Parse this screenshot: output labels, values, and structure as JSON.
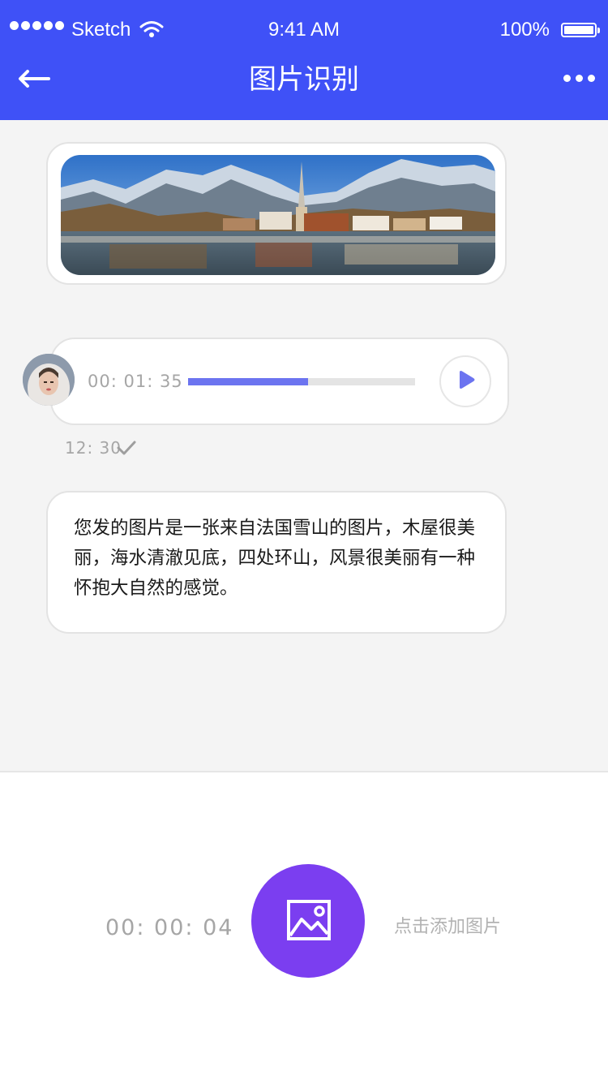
{
  "status_bar": {
    "carrier": "Sketch",
    "time": "9:41 AM",
    "battery": "100%"
  },
  "nav": {
    "title": "图片识别",
    "back_icon": "arrow-left-icon",
    "more_icon": "more-dots-icon"
  },
  "chat": {
    "image_message": {
      "alt": "lake-mountain-village-photo"
    },
    "voice_message": {
      "duration": "00: 01: 35",
      "progress": 0.53,
      "timestamp": "12: 30"
    },
    "reply_text": "您发的图片是一张来自法国雪山的图片，木屋很美丽，海水清澈见底，四处环山，风景很美丽有一种怀抱大自然的感觉。"
  },
  "bottom_panel": {
    "record_time": "00: 00: 04",
    "add_image_hint": "点击添加图片",
    "button_icon": "image-icon"
  },
  "colors": {
    "primary": "#3f51f7",
    "accent_purple": "#7b3ef0",
    "progress": "#6c74f0"
  }
}
